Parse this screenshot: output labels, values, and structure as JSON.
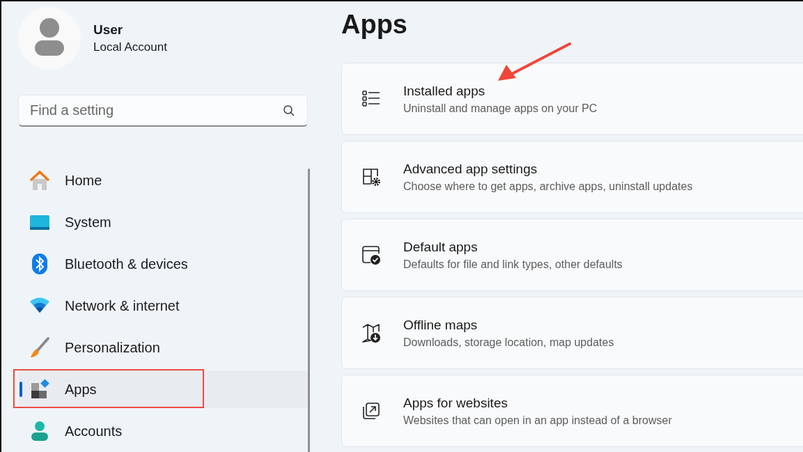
{
  "user": {
    "name": "User",
    "account_type": "Local Account"
  },
  "search": {
    "placeholder": "Find a setting"
  },
  "nav": {
    "items": [
      {
        "label": "Home",
        "selected": false,
        "highlighted": false
      },
      {
        "label": "System",
        "selected": false,
        "highlighted": false
      },
      {
        "label": "Bluetooth & devices",
        "selected": false,
        "highlighted": false
      },
      {
        "label": "Network & internet",
        "selected": false,
        "highlighted": false
      },
      {
        "label": "Personalization",
        "selected": false,
        "highlighted": false
      },
      {
        "label": "Apps",
        "selected": true,
        "highlighted": true
      },
      {
        "label": "Accounts",
        "selected": false,
        "highlighted": false
      }
    ]
  },
  "page_title": "Apps",
  "cards": [
    {
      "title": "Installed apps",
      "description": "Uninstall and manage apps on your PC",
      "pointed": true
    },
    {
      "title": "Advanced app settings",
      "description": "Choose where to get apps, archive apps, uninstall updates",
      "pointed": false
    },
    {
      "title": "Default apps",
      "description": "Defaults for file and link types, other defaults",
      "pointed": false
    },
    {
      "title": "Offline maps",
      "description": "Downloads, storage location, map updates",
      "pointed": false
    },
    {
      "title": "Apps for websites",
      "description": "Websites that can open in an app instead of a browser",
      "pointed": false
    }
  ]
}
